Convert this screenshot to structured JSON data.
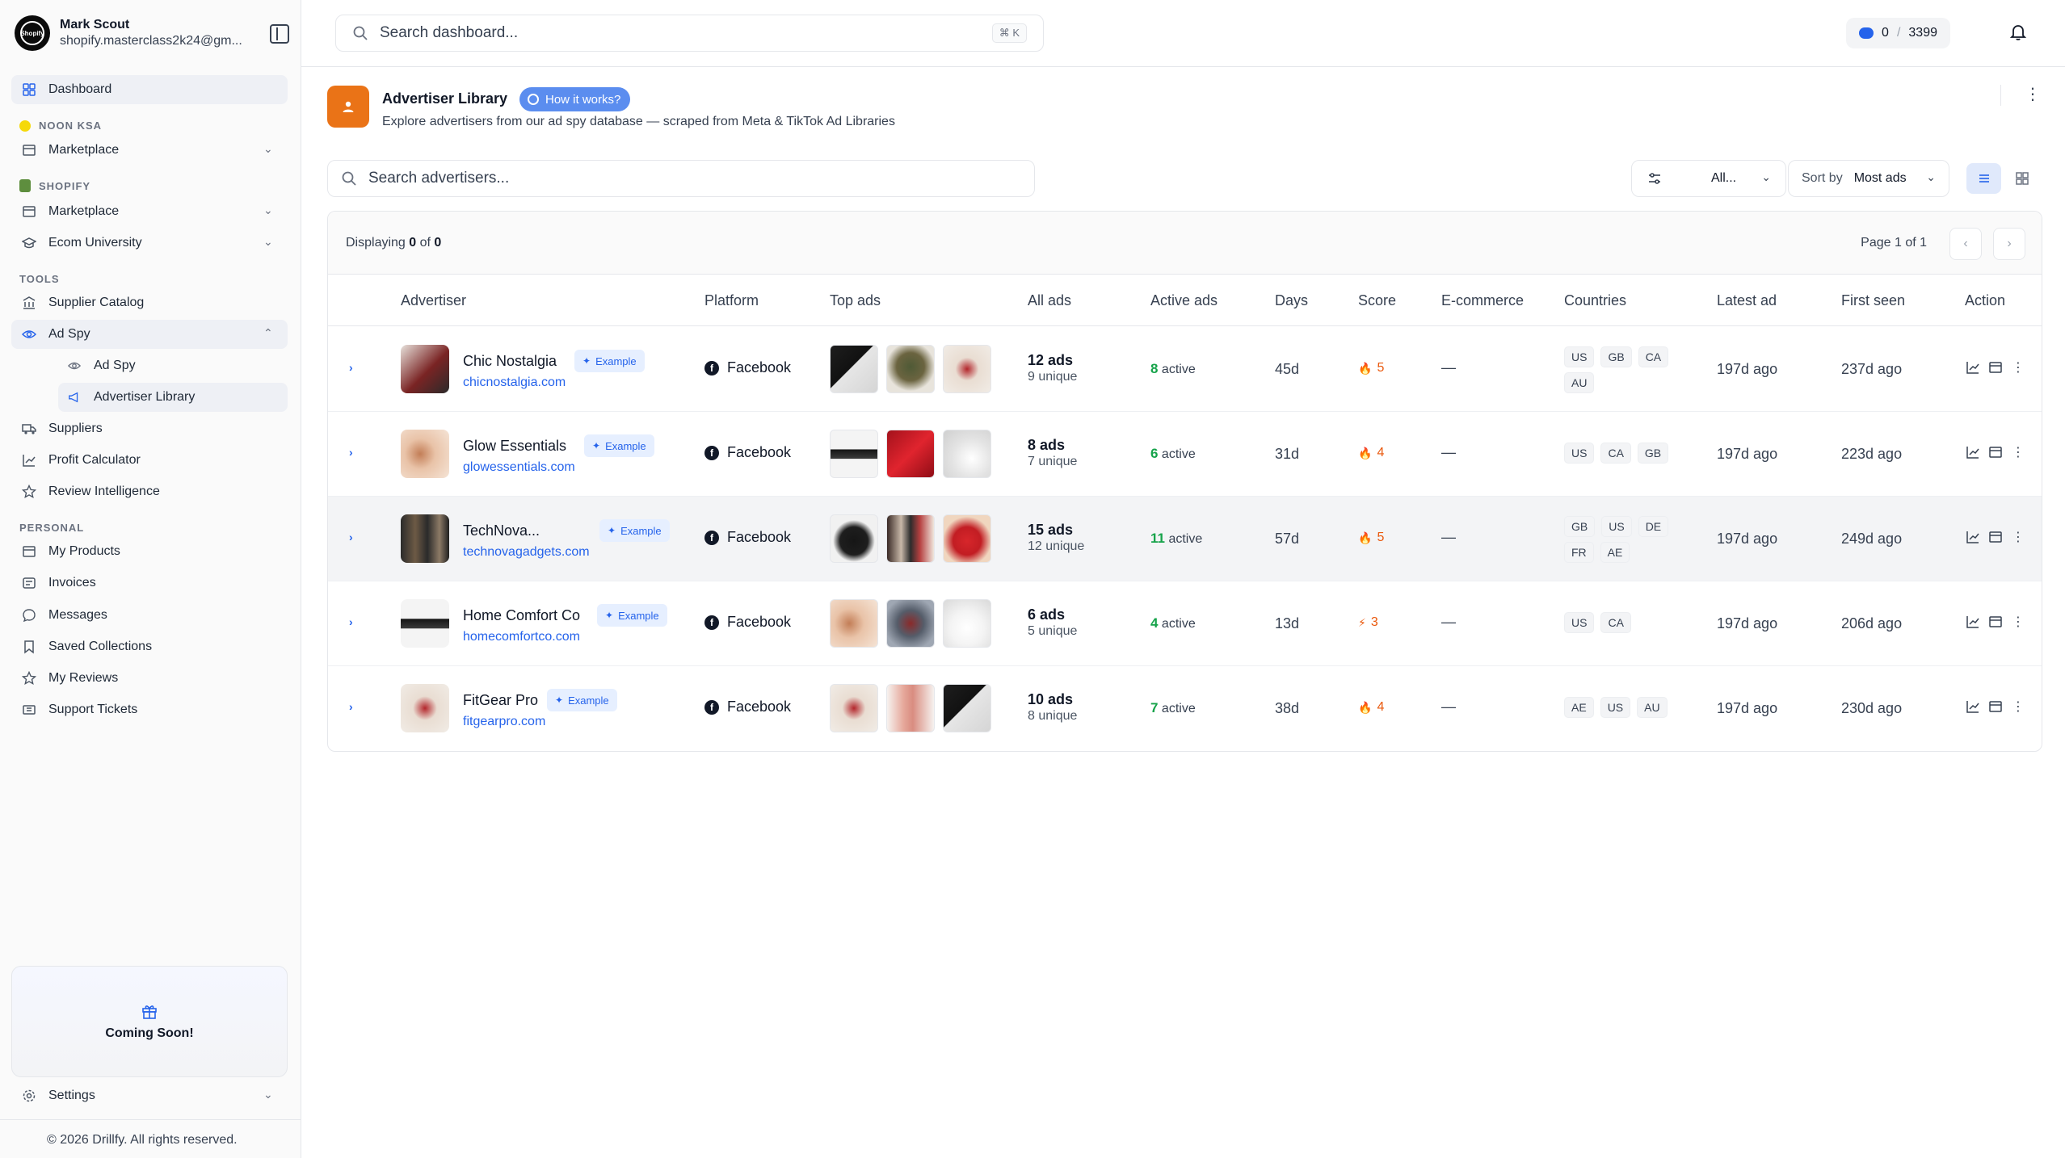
{
  "user": {
    "name": "Mark Scout",
    "email": "shopify.masterclass2k24@gm...",
    "avatar_text": "Shopify"
  },
  "sidebar": {
    "dashboard": "Dashboard",
    "noon_label": "NOON KSA",
    "noon_marketplace": "Marketplace",
    "shopify_label": "SHOPIFY",
    "shopify_marketplace": "Marketplace",
    "ecom_university": "Ecom University",
    "tools_label": "TOOLS",
    "supplier_catalog": "Supplier Catalog",
    "ad_spy": "Ad Spy",
    "ad_spy_sub": "Ad Spy",
    "advertiser_library": "Advertiser Library",
    "suppliers": "Suppliers",
    "profit_calculator": "Profit Calculator",
    "review_intelligence": "Review Intelligence",
    "personal_label": "PERSONAL",
    "my_products": "My Products",
    "invoices": "Invoices",
    "messages": "Messages",
    "saved_collections": "Saved Collections",
    "my_reviews": "My Reviews",
    "support_tickets": "Support Tickets",
    "coming_soon": "Coming Soon!",
    "settings": "Settings",
    "footer": "© 2026 Drillfy. All rights reserved."
  },
  "topbar": {
    "search_placeholder": "Search dashboard...",
    "shortcut": "⌘ K",
    "credits_used": "0",
    "credits_total": "3399"
  },
  "page": {
    "title": "Advertiser Library",
    "how_it_works": "How it works?",
    "subtitle": "Explore advertisers from our ad spy database — scraped from Meta & TikTok Ad Libraries"
  },
  "filters": {
    "search_placeholder": "Search advertisers...",
    "platform_value": "All...",
    "sort_label": "Sort by",
    "sort_value": "Most ads"
  },
  "table": {
    "displaying_prefix": "Displaying",
    "displaying_count": "0",
    "displaying_of": "of",
    "displaying_total": "0",
    "page_info": "Page 1 of 1",
    "headers": {
      "advertiser": "Advertiser",
      "platform": "Platform",
      "top_ads": "Top ads",
      "all_ads": "All ads",
      "active_ads": "Active ads",
      "days": "Days",
      "score": "Score",
      "ecommerce": "E-commerce",
      "countries": "Countries",
      "latest_ad": "Latest ad",
      "first_seen": "First seen",
      "action": "Action"
    },
    "example_label": "Example",
    "active_word": "active",
    "rows": [
      {
        "name": "Chic Nostalgia",
        "domain": "chicnostalgia.com",
        "platform": "Facebook",
        "ads": "12 ads",
        "unique": "9 unique",
        "active": "8",
        "days": "45d",
        "score": "5",
        "score_icon": "flame-icon",
        "ecommerce": "—",
        "countries": [
          "US",
          "GB",
          "CA",
          "AU"
        ],
        "latest": "197d ago",
        "first_seen": "237d ago"
      },
      {
        "name": "Glow Essentials",
        "domain": "glowessentials.com",
        "platform": "Facebook",
        "ads": "8 ads",
        "unique": "7 unique",
        "active": "6",
        "days": "31d",
        "score": "4",
        "score_icon": "flame-icon",
        "ecommerce": "—",
        "countries": [
          "US",
          "CA",
          "GB"
        ],
        "latest": "197d ago",
        "first_seen": "223d ago"
      },
      {
        "name": "TechNova...",
        "domain": "technovagadgets.com",
        "platform": "Facebook",
        "ads": "15 ads",
        "unique": "12 unique",
        "active": "11",
        "days": "57d",
        "score": "5",
        "score_icon": "flame-icon",
        "ecommerce": "—",
        "countries": [
          "GB",
          "US",
          "DE",
          "FR",
          "AE"
        ],
        "latest": "197d ago",
        "first_seen": "249d ago"
      },
      {
        "name": "Home Comfort Co",
        "domain": "homecomfortco.com",
        "platform": "Facebook",
        "ads": "6 ads",
        "unique": "5 unique",
        "active": "4",
        "days": "13d",
        "score": "3",
        "score_icon": "bolt-icon",
        "ecommerce": "—",
        "countries": [
          "US",
          "CA"
        ],
        "latest": "197d ago",
        "first_seen": "206d ago"
      },
      {
        "name": "FitGear Pro",
        "domain": "fitgearpro.com",
        "platform": "Facebook",
        "ads": "10 ads",
        "unique": "8 unique",
        "active": "7",
        "days": "38d",
        "score": "4",
        "score_icon": "flame-icon",
        "ecommerce": "—",
        "countries": [
          "AE",
          "US",
          "AU"
        ],
        "latest": "197d ago",
        "first_seen": "230d ago"
      }
    ]
  },
  "colors": {
    "accent": "#2563eb",
    "brand_orange": "#ea7317",
    "active_green": "#16a34a",
    "score_orange": "#ea580c"
  }
}
